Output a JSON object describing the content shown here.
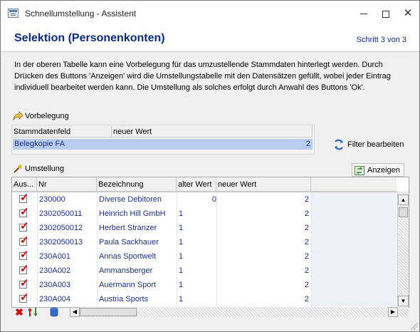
{
  "window": {
    "title": "Schnellumstellung - Assistent"
  },
  "header": {
    "title": "Selektion (Personenkonten)",
    "step": "Schritt 3 von 3"
  },
  "description": "In der oberen Tabelle kann eine Vorbelegung für das umzustellende Stammdaten hinterlegt werden. Durch Drücken des Buttons 'Anzeigen' wird die Umstellungstabelle mit den Datensätzen gefüllt, wobei jeder Eintrag individuell bearbeitet werden kann. Die Umstellung als solches erfolgt durch Anwahl des Buttons 'Ok'.",
  "vorbelegung": {
    "label": "Vorbelegung",
    "columns": [
      "Stammdatenfeld",
      "neuer Wert"
    ],
    "rows": [
      {
        "feld": "Belegkopie FA",
        "wert": "2"
      }
    ]
  },
  "filter_button": "Filter bearbeiten",
  "umstellung": {
    "label": "Umstellung",
    "anzeigen_button": "Anzeigen",
    "columns": [
      "Aus...",
      "Nr",
      "Bezeichnung",
      "alter Wert",
      "neuer Wert"
    ],
    "rows": [
      {
        "nr": "230000",
        "bez": "Diverse Debitoren",
        "alt": "0",
        "neu": "2",
        "checked": true
      },
      {
        "nr": "2302050011",
        "bez": "Heinrich Hill GmbH",
        "alt": "1",
        "neu": "2",
        "checked": true
      },
      {
        "nr": "2302050012",
        "bez": "Herbert Stranzer",
        "alt": "1",
        "neu": "2",
        "checked": true
      },
      {
        "nr": "2302050013",
        "bez": "Paula Sackhauer",
        "alt": "1",
        "neu": "2",
        "checked": true
      },
      {
        "nr": "230A001",
        "bez": "Annas Sportwelt",
        "alt": "1",
        "neu": "2",
        "checked": true
      },
      {
        "nr": "230A002",
        "bez": "Ammansberger",
        "alt": "1",
        "neu": "2",
        "checked": true
      },
      {
        "nr": "230A003",
        "bez": "Auermann Sport",
        "alt": "1",
        "neu": "2",
        "checked": true
      },
      {
        "nr": "230A004",
        "bez": "Austria Sports",
        "alt": "1",
        "neu": "2",
        "checked": true
      }
    ]
  },
  "colors": {
    "title_blue": "#0b2a82",
    "cell_text": "#1a2f8a",
    "selection": "#b9cdee",
    "check_red": "#d40000"
  },
  "icons": [
    "app-icon",
    "minimize-icon",
    "maximize-icon",
    "close-icon",
    "folder-arrow-icon",
    "filter-icon",
    "magic-wand-icon",
    "refresh-icon",
    "delete-icon",
    "sort-icon",
    "database-icon"
  ]
}
